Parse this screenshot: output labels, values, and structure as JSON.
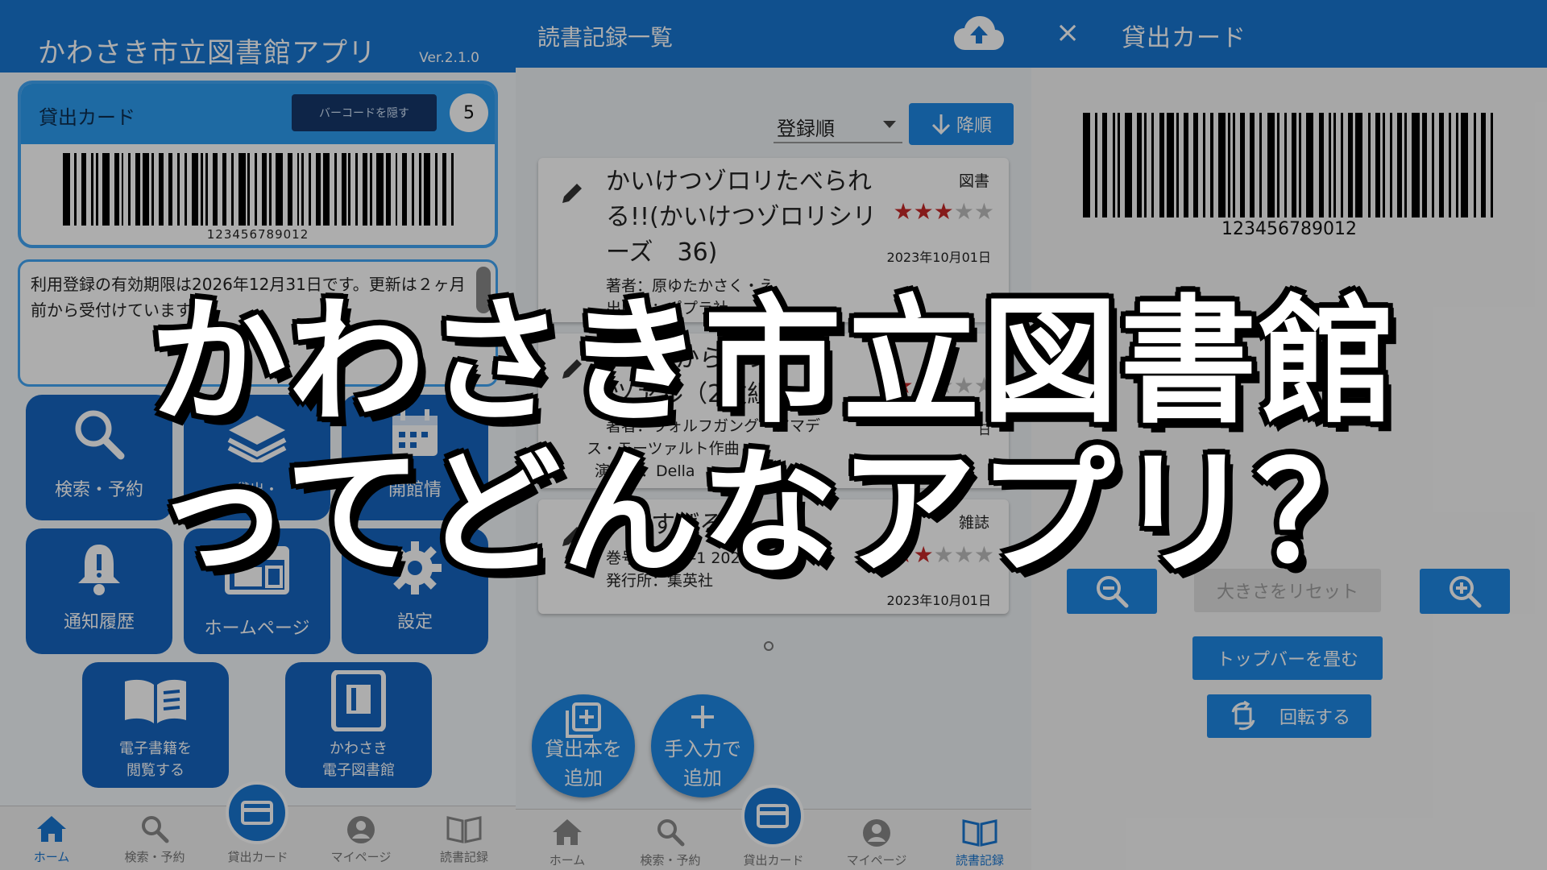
{
  "panel_home": {
    "app_title": "かわさき市立図書館アプリ",
    "version": "Ver.2.1.0",
    "card_label": "貸出カード",
    "hide_barcode_button": "バーコードを隠す",
    "loan_count": "5",
    "barcode_number": "123456789012",
    "notice": "利用登録の有効期限は2026年12月31日です。更新は２ヶ月前から受付けています。",
    "tiles": {
      "search": "検索・予約",
      "loan": "貸出・",
      "hours": "開館情",
      "notifications": "通知履歴",
      "homepage": "ホームページ",
      "settings": "設定",
      "ebook_line1": "電子書籍を",
      "ebook_line2": "閲覧する",
      "elibrary_line1": "かわさき",
      "elibrary_line2": "電子図書館"
    },
    "nav": [
      "ホーム",
      "検索・予約",
      "貸出カード",
      "マイページ",
      "読書記録"
    ]
  },
  "panel_records": {
    "title": "読書記録一覧",
    "sort_value": "登録順",
    "order_button": "降順",
    "records": [
      {
        "title_line1": "かいけつゾロリたべられ",
        "title_line2": "る!!(かいけつゾロリシリ",
        "title_line3": "ーズ　36)",
        "type": "図書",
        "rating": 3,
        "date": "2023年10月01日",
        "author": "著者：原ゆたかさく・え",
        "publisher": "出版社：ポプラ社"
      },
      {
        "title_line1": "からのシッ",
        "title_line2": "ツァル（2枚組)",
        "type": "",
        "rating": 1,
        "date": "日",
        "author": "著者：ヴォルフガング・アマデ",
        "author2": "ス・モーツァルト作曲",
        "publisher": "演奏者：Della"
      },
      {
        "title_line1": "説すばる",
        "type": "雑誌",
        "rating": 2,
        "date": "2023年10月01日",
        "volume": "巻号：2022-1 2021年　1号",
        "publisher": "発行所：集英社"
      }
    ],
    "fab_add_loan_line1": "貸出本を",
    "fab_add_loan_line2": "追加",
    "fab_manual_line1": "手入力で",
    "fab_manual_line2": "追加",
    "nav": [
      "ホーム",
      "検索・予約",
      "貸出カード",
      "マイページ",
      "読書記録"
    ]
  },
  "panel_card": {
    "title": "貸出カード",
    "close": "×",
    "barcode_number": "123456789012",
    "reset_button": "大きさをリセット",
    "fold_button": "トップバーを畳む",
    "rotate_button": "回転する"
  },
  "overlay": {
    "line1": "かわさき市立図書館",
    "line2": "ってどんなアプリ？"
  },
  "colors": {
    "primary": "#1976d2",
    "tile": "#1565c0",
    "star_on": "#c62828",
    "star_off": "#bdbdbd"
  }
}
